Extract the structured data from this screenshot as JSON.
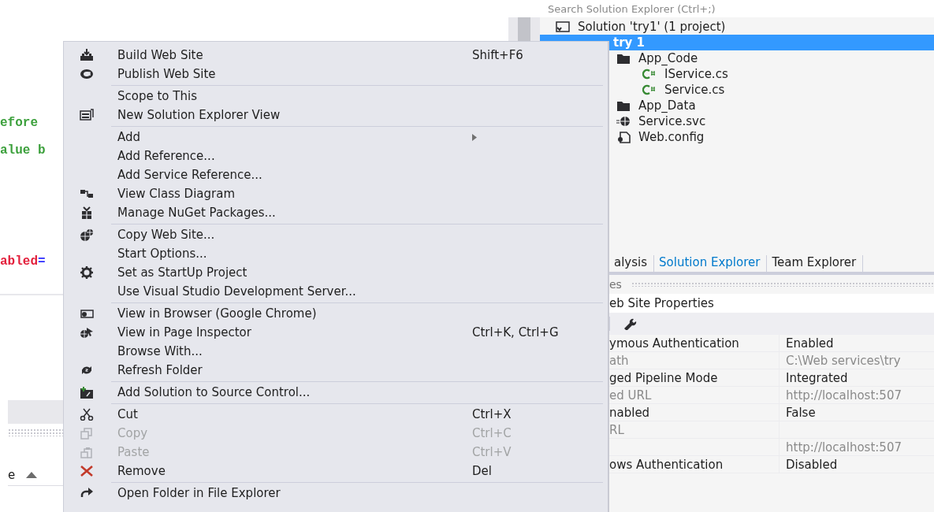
{
  "editor": {
    "code_lines": [
      {
        "segments": [
          {
            "text": "efore",
            "kind": "comment"
          }
        ]
      },
      {
        "segments": [
          {
            "text": "alue b",
            "kind": "comment"
          }
        ]
      },
      {
        "segments": [
          {
            "text": "abled",
            "kind": "attribute"
          },
          {
            "text": "=",
            "kind": "operator"
          }
        ]
      }
    ],
    "list_header": {
      "label": "e"
    }
  },
  "solution_explorer": {
    "search": {
      "placeholder": "Search Solution Explorer (Ctrl+;)"
    },
    "tree": [
      {
        "label": "Solution 'try1' (1 project)",
        "selected": false,
        "children": [
          {
            "label": "try 1",
            "selected": true,
            "children": [
              {
                "label": "App_Code",
                "selected": false,
                "children": [
                  {
                    "label": "IService.cs",
                    "selected": false
                  },
                  {
                    "label": "Service.cs",
                    "selected": false
                  }
                ]
              },
              {
                "label": "App_Data",
                "selected": false
              },
              {
                "label": "Service.svc",
                "selected": false
              },
              {
                "label": "Web.config",
                "selected": false
              }
            ]
          }
        ]
      }
    ],
    "tabs": [
      {
        "label": "alysis",
        "selected": false
      },
      {
        "label": "Solution Explorer",
        "selected": true
      },
      {
        "label": "Team Explorer",
        "selected": false
      }
    ]
  },
  "properties": {
    "title": "es",
    "object": "eb Site Properties",
    "rows": [
      {
        "name": "ymous Authentication",
        "value": "Enabled",
        "readonly": false
      },
      {
        "name": "ath",
        "value": "C:\\Web services\\try",
        "readonly": true
      },
      {
        "name": "ged Pipeline Mode",
        "value": "Integrated",
        "readonly": false
      },
      {
        "name": "ed URL",
        "value": "http://localhost:507",
        "readonly": true
      },
      {
        "name": "nabled",
        "value": "False",
        "readonly": false
      },
      {
        "name": "RL",
        "readonly": true
      },
      {
        "value": "http://localhost:507",
        "readonly": true
      },
      {
        "name": "ows Authentication",
        "value": "Disabled",
        "readonly": false
      }
    ]
  },
  "context_menu": {
    "groups": [
      [
        {
          "label": "Build Web Site",
          "shortcut": "Shift+F6",
          "disabled": false
        },
        {
          "label": "Publish Web Site",
          "disabled": false
        }
      ],
      [
        {
          "label": "Scope to This",
          "disabled": false
        },
        {
          "label": "New Solution Explorer View",
          "disabled": false
        }
      ],
      [
        {
          "label": "Add",
          "disabled": false,
          "submenu": true
        },
        {
          "label": "Add Reference...",
          "disabled": false
        },
        {
          "label": "Add Service Reference...",
          "disabled": false
        },
        {
          "label": "View Class Diagram",
          "disabled": false
        },
        {
          "label": "Manage NuGet Packages...",
          "disabled": false
        }
      ],
      [
        {
          "label": "Copy Web Site...",
          "disabled": false
        },
        {
          "label": "Start Options...",
          "disabled": false
        },
        {
          "label": "Set as StartUp Project",
          "disabled": false
        },
        {
          "label": "Use Visual Studio Development Server...",
          "disabled": false
        }
      ],
      [
        {
          "label": "View in Browser (Google Chrome)",
          "disabled": false
        },
        {
          "label": "View in Page Inspector",
          "shortcut": "Ctrl+K, Ctrl+G",
          "disabled": false
        },
        {
          "label": "Browse With...",
          "disabled": false
        },
        {
          "label": "Refresh Folder",
          "disabled": false
        }
      ],
      [
        {
          "label": "Add Solution to Source Control...",
          "disabled": false
        }
      ],
      [
        {
          "label": "Cut",
          "shortcut": "Ctrl+X",
          "disabled": false
        },
        {
          "label": "Copy",
          "shortcut": "Ctrl+C",
          "disabled": true
        },
        {
          "label": "Paste",
          "shortcut": "Ctrl+V",
          "disabled": true
        },
        {
          "label": "Remove",
          "shortcut": "Del",
          "disabled": false
        }
      ],
      [
        {
          "label": "Open Folder in File Explorer",
          "disabled": false
        }
      ]
    ]
  }
}
